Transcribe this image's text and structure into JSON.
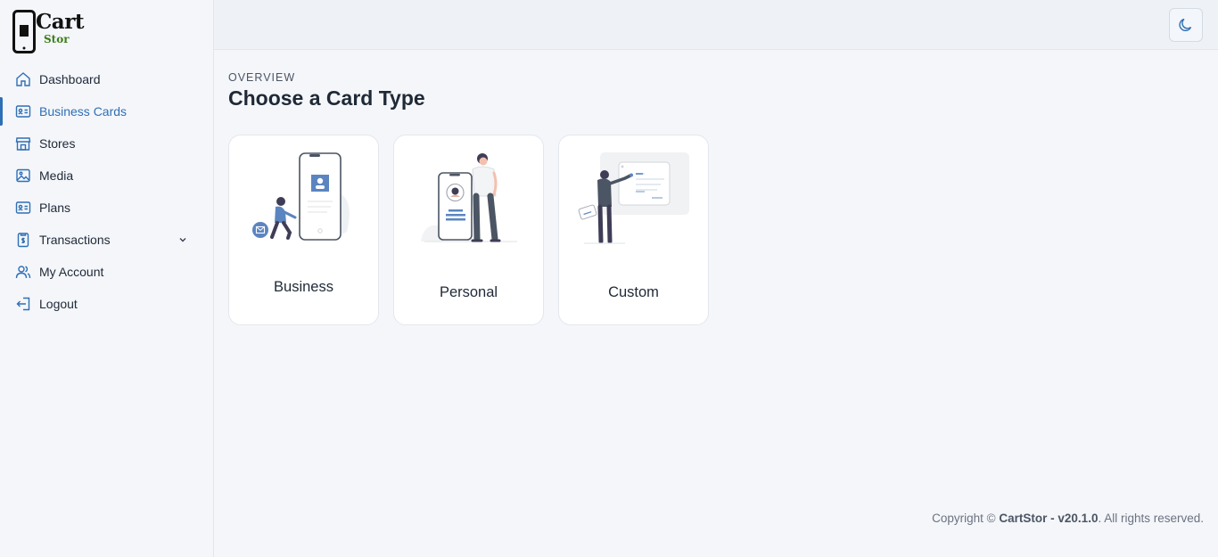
{
  "brand": {
    "name_top": "Cart",
    "name_bottom": "Stor"
  },
  "nav": [
    {
      "label": "Dashboard",
      "icon": "home-icon"
    },
    {
      "label": "Business Cards",
      "icon": "id-card-icon",
      "active": true
    },
    {
      "label": "Stores",
      "icon": "store-icon"
    },
    {
      "label": "Media",
      "icon": "image-icon"
    },
    {
      "label": "Plans",
      "icon": "id-card-icon"
    },
    {
      "label": "Transactions",
      "icon": "receipt-icon",
      "expandable": true
    },
    {
      "label": "My Account",
      "icon": "users-icon"
    },
    {
      "label": "Logout",
      "icon": "logout-icon"
    }
  ],
  "header": {
    "theme_toggle_icon": "moon-icon"
  },
  "main": {
    "overview": "OVERVIEW",
    "title": "Choose a Card Type",
    "cards": [
      {
        "label": "Business"
      },
      {
        "label": "Personal"
      },
      {
        "label": "Custom"
      }
    ]
  },
  "footer": {
    "prefix": "Copyright ©",
    "brand_version": "CartStor - v20.1.0",
    "suffix": ". All rights reserved."
  },
  "colors": {
    "accent": "#2f6fb5",
    "brand_green": "#3f7d1a",
    "background": "#f4f6fa"
  }
}
